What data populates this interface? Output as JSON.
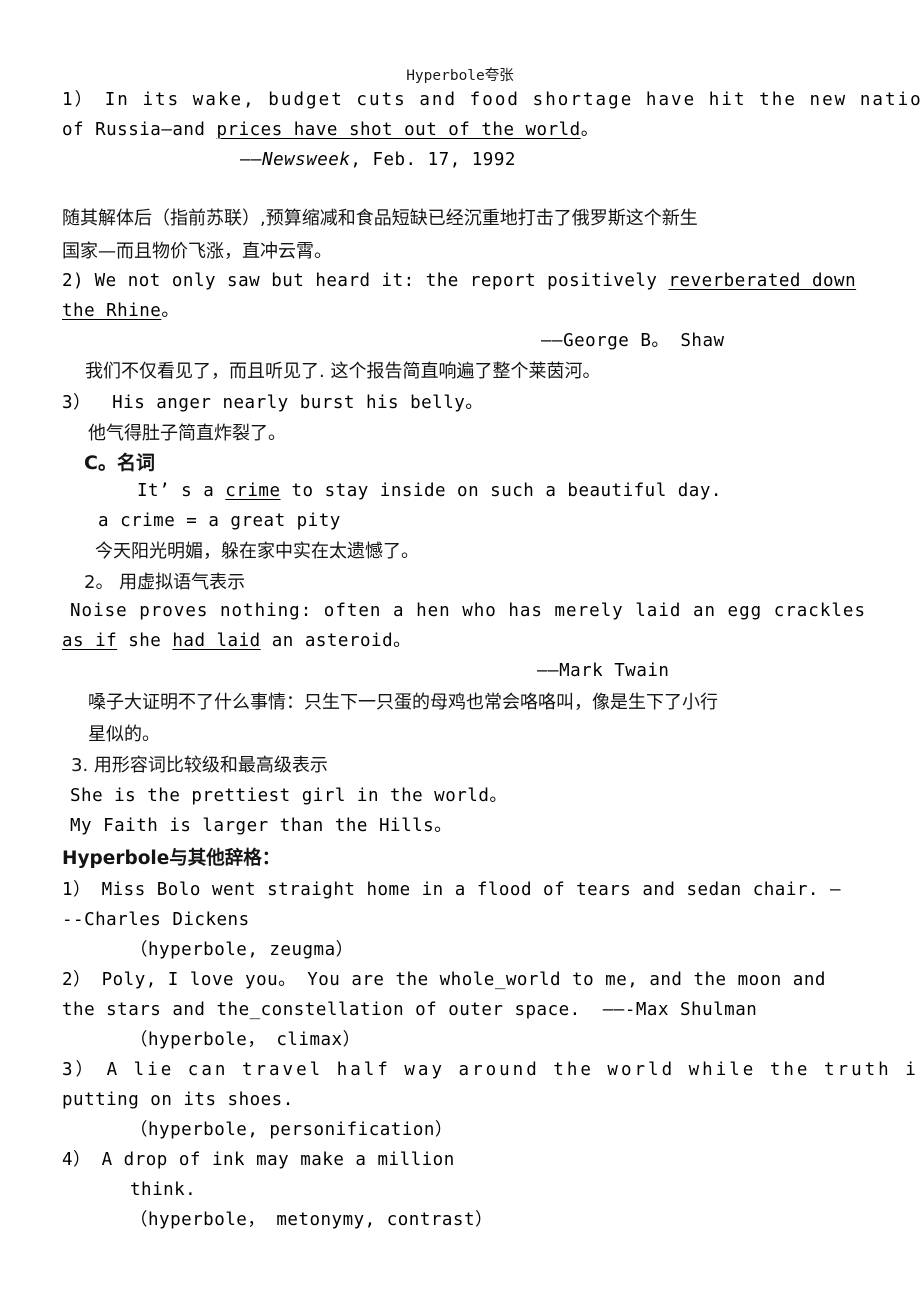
{
  "document": {
    "title": "Hyperbole夸张",
    "sections": {
      "examples_group_1": [
        {
          "marker": "1）",
          "en_line1": "In its wake, budget cuts and food shortage have hit the new nation",
          "en_line2_pre": "of Russia—and ",
          "en_line2_underlined": "prices have shot out of the world",
          "en_line2_post": "。",
          "attribution": "——Newsweek, Feb. 17, 1992",
          "attribution_dash": "——",
          "attribution_italic": "Newsweek",
          "attribution_rest": ", Feb. 17, 1992",
          "cn_line1": "随其解体后（指前苏联）,预算缩减和食品短缺已经沉重地打击了俄罗斯这个新生",
          "cn_line2": "国家—而且物价飞涨，直冲云霄。"
        },
        {
          "marker": "2)",
          "en_line1_pre": "We not only saw but heard it: the report positively ",
          "en_line1_underlined": "reverberated down",
          "en_line2_underlined": "the Rhine",
          "en_line2_post": "。",
          "attribution": "——George B。 Shaw",
          "cn_line1": "我们不仅看见了，而且听见了. 这个报告简直响遍了整个莱茵河。"
        },
        {
          "marker": "3）",
          "en_line1": "His anger nearly burst his belly。",
          "cn_line1": "他气得肚子简直炸裂了。"
        }
      ],
      "section_c": {
        "heading": "C。名词",
        "example_en": "It’s a crime to stay inside on such a beautiful day.",
        "example_en_pre": "It’ s a ",
        "example_en_underlined": "crime",
        "example_en_post": " to stay inside on such a beautiful day.",
        "gloss": "a crime = a great pity",
        "cn_translation": "今天阳光明媚，躲在家中实在太遗憾了。"
      },
      "section_2": {
        "heading": "2。 用虚拟语气表示",
        "en_line1": "Noise proves nothing: often a hen who has merely laid an egg crackles",
        "en_line2_underlined_1": "as if",
        "en_line2_mid": " she ",
        "en_line2_underlined_2": "had laid",
        "en_line2_post": " an asteroid。",
        "attribution": "——Mark Twain",
        "cn_line1": "嗓子大证明不了什么事情：只生下一只蛋的母鸡也常会咯咯叫，像是生下了小行",
        "cn_line2": "星似的。"
      },
      "section_3": {
        "heading": "3. 用形容词比较级和最高级表示",
        "en_line1": "She is the prettiest girl in the world。",
        "en_line2": "My Faith is larger than the Hills。"
      },
      "section_other": {
        "heading": "Hyperbole与其他辞格：",
        "items": [
          {
            "marker": "1）",
            "line1": "Miss Bolo went straight home in a flood of tears and sedan chair. —",
            "line2": "--Charles Dickens",
            "tags": "（hyperbole, zeugma）"
          },
          {
            "marker": "2）",
            "line1": "Poly, I love you。 You are the whole_world to me, and the moon and",
            "line2": "the stars and the_constellation of outer space.  ——-Max Shulman",
            "tags": "（hyperbole， climax）"
          },
          {
            "marker": "3）",
            "line1": "A lie can travel half way around the world while the truth is",
            "line2": "putting on its shoes.",
            "tags": "（hyperbole, personification）"
          },
          {
            "marker": "4）",
            "line1": "A drop of ink may make a million",
            "line2": "think.",
            "tags": "（hyperbole， metonymy, contrast）"
          }
        ]
      }
    }
  }
}
